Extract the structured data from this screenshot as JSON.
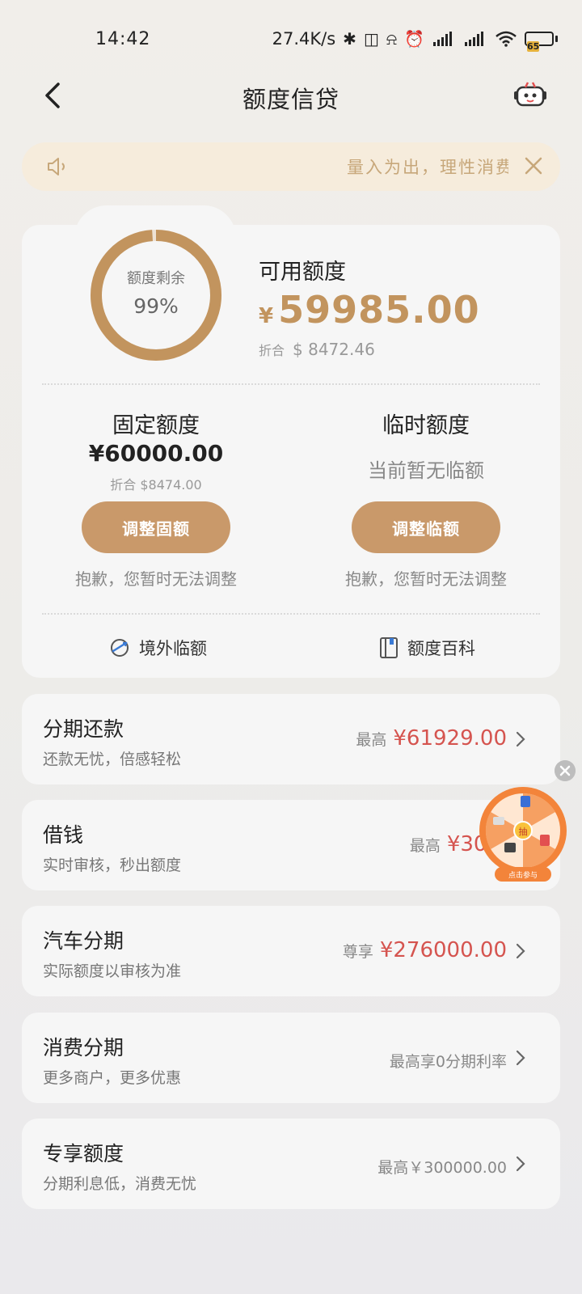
{
  "status_bar": {
    "time": "14:42",
    "net_speed": "27.4K/s",
    "battery": "65"
  },
  "nav": {
    "title": "额度信贷"
  },
  "notice": {
    "text": "量入为出，理性消费"
  },
  "credit": {
    "ring_label": "额度剩余",
    "ring_value": "99%",
    "ring_fraction": 0.99,
    "available_label": "可用额度",
    "available_currency": "¥",
    "available_amount": "59985.00",
    "available_equiv_label": "折合",
    "available_equiv_value": "$ 8472.46",
    "fixed": {
      "title": "固定额度",
      "amount": "¥60000.00",
      "equiv": "折合 $8474.00",
      "button": "调整固额",
      "note": "抱歉，您暂时无法调整"
    },
    "temp": {
      "title": "临时额度",
      "none_text": "当前暂无临额",
      "button": "调整临额",
      "note": "抱歉，您暂时无法调整"
    },
    "links": {
      "overseas": "境外临额",
      "wiki": "额度百科"
    }
  },
  "items": [
    {
      "title": "分期还款",
      "sub": "还款无忧，倍感轻松",
      "prefix": "最高",
      "value": "¥61929.00"
    },
    {
      "title": "借钱",
      "sub": "实时审核，秒出额度",
      "prefix": "最高",
      "value": "¥300"
    },
    {
      "title": "汽车分期",
      "sub": "实际额度以审核为准",
      "prefix": "尊享",
      "value": "¥276000.00"
    },
    {
      "title": "消费分期",
      "sub": "更多商户，更多优惠",
      "prefix": "",
      "value": "最高享0分期利率"
    },
    {
      "title": "专享额度",
      "sub": "分期利息低，消费无忧",
      "prefix": "",
      "value": "最高￥300000.00"
    }
  ],
  "float_wheel": {
    "center_label": "抽",
    "caption": "点击参与"
  },
  "colors": {
    "accent": "#c2945e",
    "button": "#c9996a",
    "red": "#d5544f",
    "notice_bg": "#f6ecdc"
  }
}
